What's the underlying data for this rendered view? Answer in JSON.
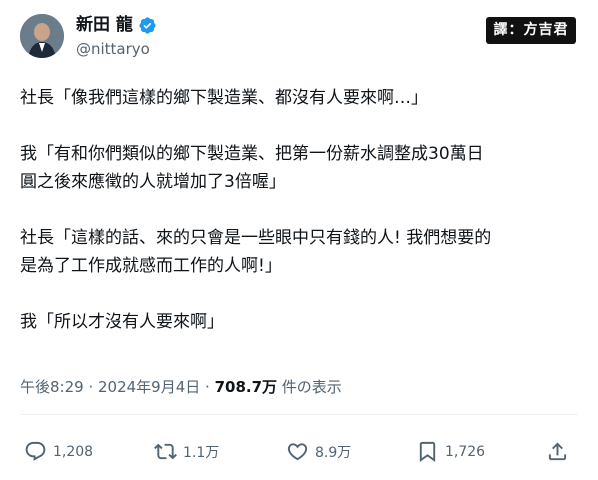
{
  "author": {
    "display_name": "新田 龍",
    "handle": "@nittaryo"
  },
  "watermark": "譯：方吉君",
  "tweet": {
    "paragraphs": [
      "社長「像我們這樣的鄉下製造業、都沒有人要來啊…」",
      "我「有和你們類似的鄉下製造業、把第一份薪水調整成30萬日\n圓之後來應徵的人就增加了3倍喔」",
      "社長「這樣的話、來的只會是一些眼中只有錢的人! 我們想要的\n是為了工作成就感而工作的人啊!」",
      "我「所以才沒有人要來啊」"
    ],
    "time": "午後8:29",
    "sep1": " · ",
    "date": "2024年9月4日",
    "sep2": " · ",
    "views": "708.7万",
    "views_label": " 件の表示"
  },
  "actions": {
    "replies": "1,208",
    "retweets": "1.1万",
    "likes": "8.9万",
    "bookmarks": "1,726"
  },
  "icons": {
    "verified": "verified-badge-icon",
    "reply": "reply-icon",
    "retweet": "retweet-icon",
    "like": "heart-icon",
    "bookmark": "bookmark-icon",
    "share": "share-icon"
  },
  "colors": {
    "verified": "#1d9bf0",
    "muted_text": "#536471",
    "text": "#0f1419"
  }
}
